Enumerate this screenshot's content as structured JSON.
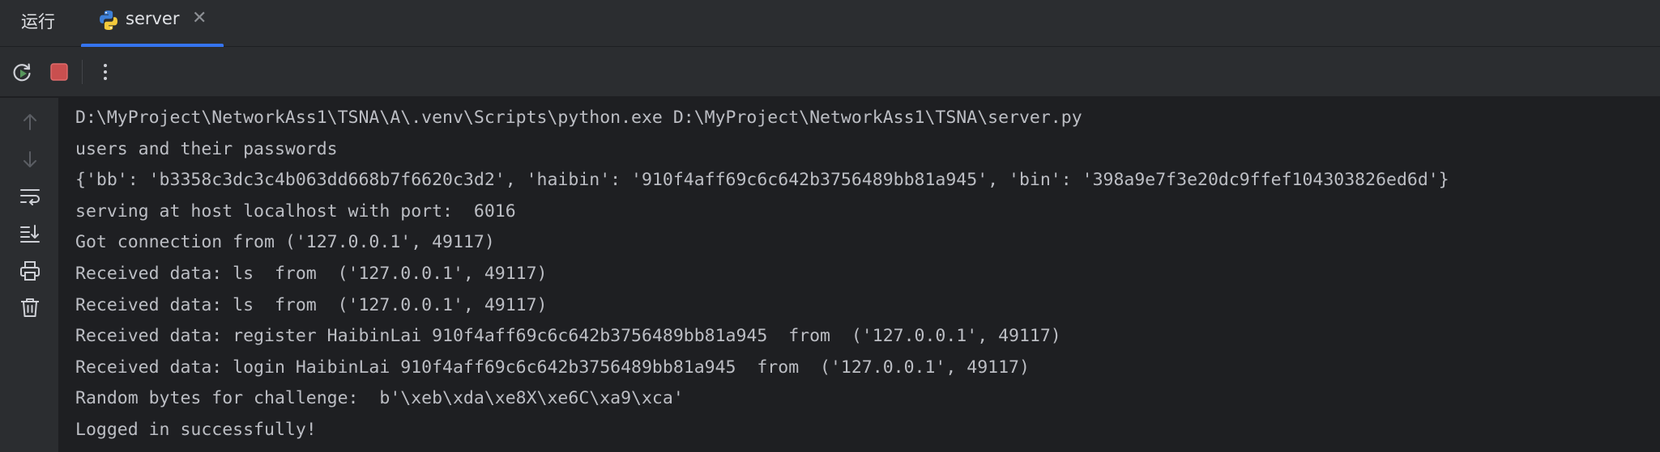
{
  "toolwindow": {
    "title": "运行",
    "tab": {
      "label": "server",
      "close": "✕",
      "icon": "python-icon"
    }
  },
  "toolbar": {
    "rerun_icon": "rerun-icon",
    "stop_icon": "stop-icon",
    "more_icon": "more-vertical-icon"
  },
  "gutter": {
    "icons": [
      "arrow-up-icon",
      "arrow-down-icon",
      "soft-wrap-icon",
      "scroll-to-end-icon",
      "print-icon",
      "trash-icon"
    ]
  },
  "console": {
    "lines": [
      "D:\\MyProject\\NetworkAss1\\TSNA\\A\\.venv\\Scripts\\python.exe D:\\MyProject\\NetworkAss1\\TSNA\\server.py",
      "users and their passwords",
      "{'bb': 'b3358c3dc3c4b063dd668b7f6620c3d2', 'haibin': '910f4aff69c6c642b3756489bb81a945', 'bin': '398a9e7f3e20dc9ffef104303826ed6d'}",
      "serving at host localhost with port:  6016",
      "Got connection from ('127.0.0.1', 49117)",
      "Received data: ls  from  ('127.0.0.1', 49117)",
      "Received data: ls  from  ('127.0.0.1', 49117)",
      "Received data: register HaibinLai 910f4aff69c6c642b3756489bb81a945  from  ('127.0.0.1', 49117)",
      "Received data: login HaibinLai 910f4aff69c6c642b3756489bb81a945  from  ('127.0.0.1', 49117)",
      "Random bytes for challenge:  b'\\xeb\\xda\\xe8X\\xe6C\\xa9\\xca'",
      "Logged in successfully!"
    ]
  },
  "colors": {
    "panel": "#2b2d30",
    "editor": "#1e1f22",
    "text": "#bcbec4",
    "accent": "#3574f0",
    "stop": "#c94f4f",
    "rerun_play": "#57965c"
  }
}
